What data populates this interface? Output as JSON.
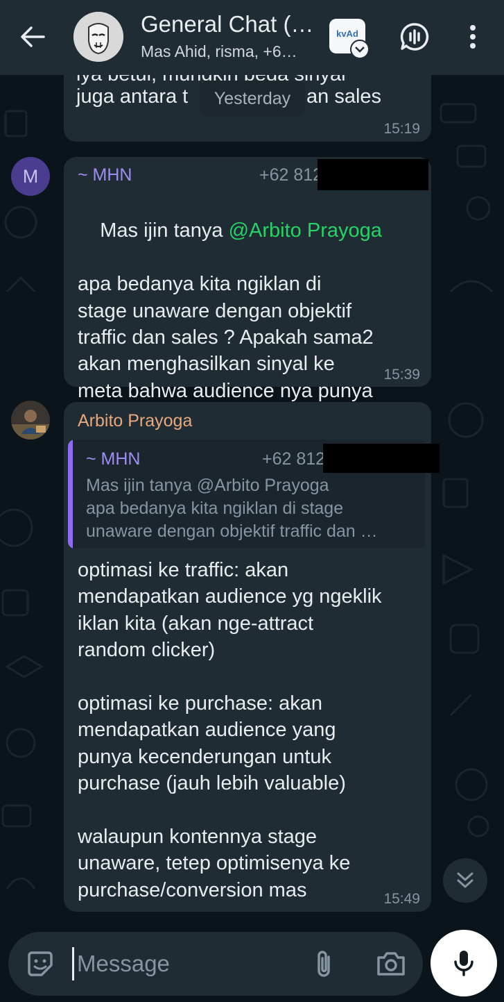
{
  "header": {
    "title": "General Chat (…",
    "subtitle": "Mas Ahid, risma, +6…",
    "app_badge_text": "kvAd"
  },
  "date_chip": "Yesterday",
  "messages": [
    {
      "text_partial_line1": "iya betul, mungkin beda sinyal",
      "text_line2_start": "juga antara t",
      "text_line2_end": "an sales",
      "time": "15:19"
    },
    {
      "avatar_letter": "M",
      "sender": "~ MHN",
      "phone": "+62 812",
      "text_before_mention": "Mas ijin tanya ",
      "mention": "@Arbito Prayoga",
      "text_after_mention": "apa bedanya kita ngiklan di\nstage unaware dengan objektif\ntraffic dan sales ? Apakah sama2\nakan menghasilkan sinyal ke\nmeta bahwa audience nya punya\nketertarikan?",
      "time": "15:39"
    },
    {
      "sender": "Arbito Prayoga",
      "quote": {
        "sender": "~ MHN",
        "phone": "+62 812",
        "text": "Mas ijin tanya @Arbito Prayoga\napa bedanya kita ngiklan di stage\nunaware dengan objektif traffic dan …"
      },
      "text": "optimasi ke traffic: akan\nmendapatkan audience yg ngeklik\niklan kita (akan nge-attract\nrandom clicker)\n\noptimasi ke purchase: akan\nmendapatkan audience yang\npunya kecenderungan untuk\npurchase (jauh lebih valuable)\n\nwalaupun kontennya stage\nunaware, tetep optimisenya ke\npurchase/conversion mas",
      "time": "15:49"
    }
  ],
  "composer": {
    "placeholder": "Message"
  },
  "colors": {
    "background": "#0b141a",
    "bubble": "#1f2c34",
    "mhn_name": "#a08cf0",
    "arbito_name": "#e8a87c",
    "mention": "#25d366",
    "quote_bar": "#8e6cef"
  }
}
